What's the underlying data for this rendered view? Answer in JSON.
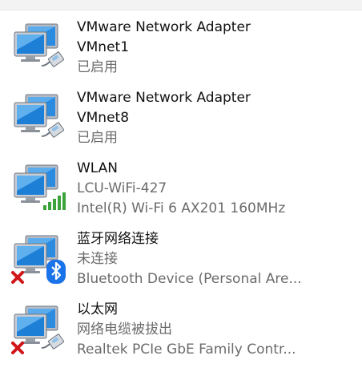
{
  "adapters": [
    {
      "line1": "VMware Network Adapter",
      "line2": "VMnet1",
      "line3": "已启用",
      "icon": "network-adapter-icon",
      "overlay": "ethernet-cable-icon",
      "status": "enabled"
    },
    {
      "line1": "VMware Network Adapter",
      "line2": "VMnet8",
      "line3": "已启用",
      "icon": "network-adapter-icon",
      "overlay": "ethernet-cable-icon",
      "status": "enabled"
    },
    {
      "line1": "WLAN",
      "line2": "LCU-WiFi-427",
      "line3": "Intel(R) Wi-Fi 6 AX201 160MHz",
      "icon": "network-adapter-icon",
      "overlay": "wifi-signal-icon",
      "status": "connected"
    },
    {
      "line1": "蓝牙网络连接",
      "line2": "未连接",
      "line3": "Bluetooth Device (Personal Are...",
      "icon": "network-adapter-icon",
      "overlay": "bluetooth-icon",
      "status": "disconnected"
    },
    {
      "line1": "以太网",
      "line2": "网络电缆被拔出",
      "line3": "Realtek PCIe GbE Family Contr...",
      "icon": "network-adapter-icon",
      "overlay": "ethernet-cable-icon",
      "status": "cable-unplugged"
    }
  ],
  "colors": {
    "monitor_blue": "#1e7fd6",
    "wifi_green": "#3aa33a",
    "bluetooth_blue": "#1a73e8",
    "error_red": "#d0161b"
  }
}
